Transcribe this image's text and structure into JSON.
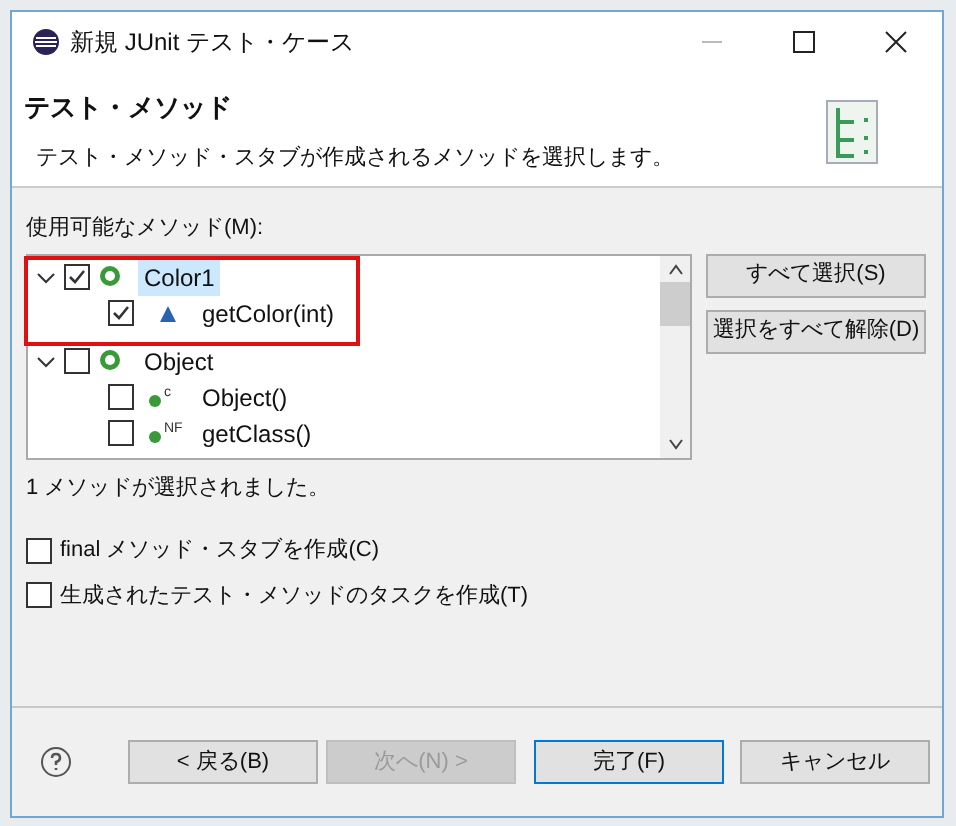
{
  "window": {
    "title": "新規 JUnit テスト・ケース"
  },
  "header": {
    "title": "テスト・メソッド",
    "description": "テスト・メソッド・スタブが作成されるメソッドを選択します。"
  },
  "methods": {
    "label": "使用可能なメソッド(M):",
    "tree": [
      {
        "label": "Color1",
        "kind": "class",
        "checked": true,
        "expanded": true,
        "selected": true,
        "children": [
          {
            "label": "getColor(int)",
            "kind": "default",
            "checked": true,
            "selected": false
          }
        ]
      },
      {
        "label": "Object",
        "kind": "class",
        "checked": false,
        "expanded": true,
        "selected": false,
        "children": [
          {
            "label": "Object()",
            "kind": "public",
            "modifier": "c",
            "checked": false,
            "selected": false
          },
          {
            "label": "getClass()",
            "kind": "public",
            "modifier": "NF",
            "checked": false,
            "selected": false
          }
        ]
      }
    ]
  },
  "side_buttons": [
    "すべて選択(S)",
    "選択をすべて解除(D)"
  ],
  "status": "1 メソッドが選択されました。",
  "options": [
    {
      "label": "final メソッド・スタブを作成(C)",
      "checked": false
    },
    {
      "label": "生成されたテスト・メソッドのタスクを作成(T)",
      "checked": false
    }
  ],
  "buttons": [
    {
      "label": "< 戻る(B)",
      "disabled": false,
      "default": false
    },
    {
      "label": "次へ(N) >",
      "disabled": true,
      "default": false
    },
    {
      "label": "完了(F)",
      "disabled": false,
      "default": true
    },
    {
      "label": "キャンセル",
      "disabled": false,
      "default": false
    }
  ],
  "highlight": true
}
